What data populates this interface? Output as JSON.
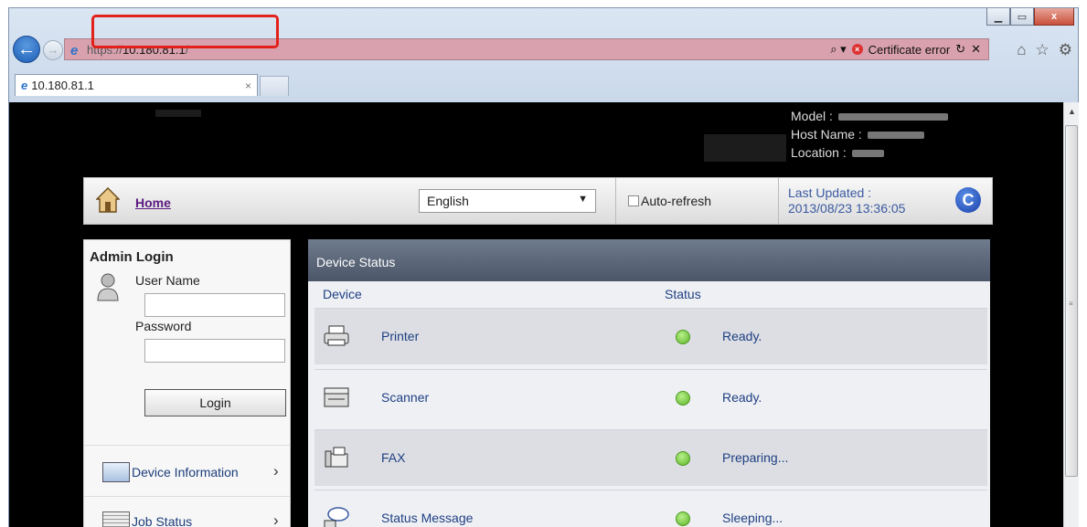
{
  "browser": {
    "url_prefix": "https://",
    "url_host": "10.180.81.1",
    "url_suffix": "/",
    "search_icon": "search-icon",
    "cert_error": "Certificate error",
    "refresh_symbol": "↻",
    "stop_symbol": "✕",
    "tab_title": "10.180.81.1",
    "tab_close": "×",
    "highlight_color": "#e2211a",
    "min_symbol": "▁",
    "max_symbol": "▭",
    "close_symbol": "x",
    "home_glyph": "⌂",
    "fav_glyph": "☆",
    "gear_glyph": "⚙"
  },
  "device_header": {
    "model_label": "Model :",
    "host_label": "Host Name :",
    "location_label": "Location :"
  },
  "toolbar": {
    "home_label": "Home",
    "language": "English",
    "auto_refresh": "Auto-refresh",
    "last_updated_label": "Last Updated :",
    "last_updated_value": "2013/08/23 13:36:05"
  },
  "sidebar": {
    "title": "Admin Login",
    "username_label": "User Name",
    "password_label": "Password",
    "login_button": "Login",
    "items": [
      {
        "label": "Device Information",
        "icon": "device-info-icon"
      },
      {
        "label": "Job Status",
        "icon": "job-status-icon"
      }
    ]
  },
  "main": {
    "title": "Device Status",
    "col_device": "Device",
    "col_status": "Status",
    "rows": [
      {
        "device": "Printer",
        "status": "Ready.",
        "icon": "printer-icon",
        "dot": "#5fb52a"
      },
      {
        "device": "Scanner",
        "status": "Ready.",
        "icon": "scanner-icon",
        "dot": "#5fb52a"
      },
      {
        "device": "FAX",
        "status": "Preparing...",
        "icon": "fax-icon",
        "dot": "#5fb52a"
      },
      {
        "device": "Status Message",
        "status": "Sleeping...",
        "icon": "status-message-icon",
        "dot": "#5fb52a"
      }
    ]
  }
}
